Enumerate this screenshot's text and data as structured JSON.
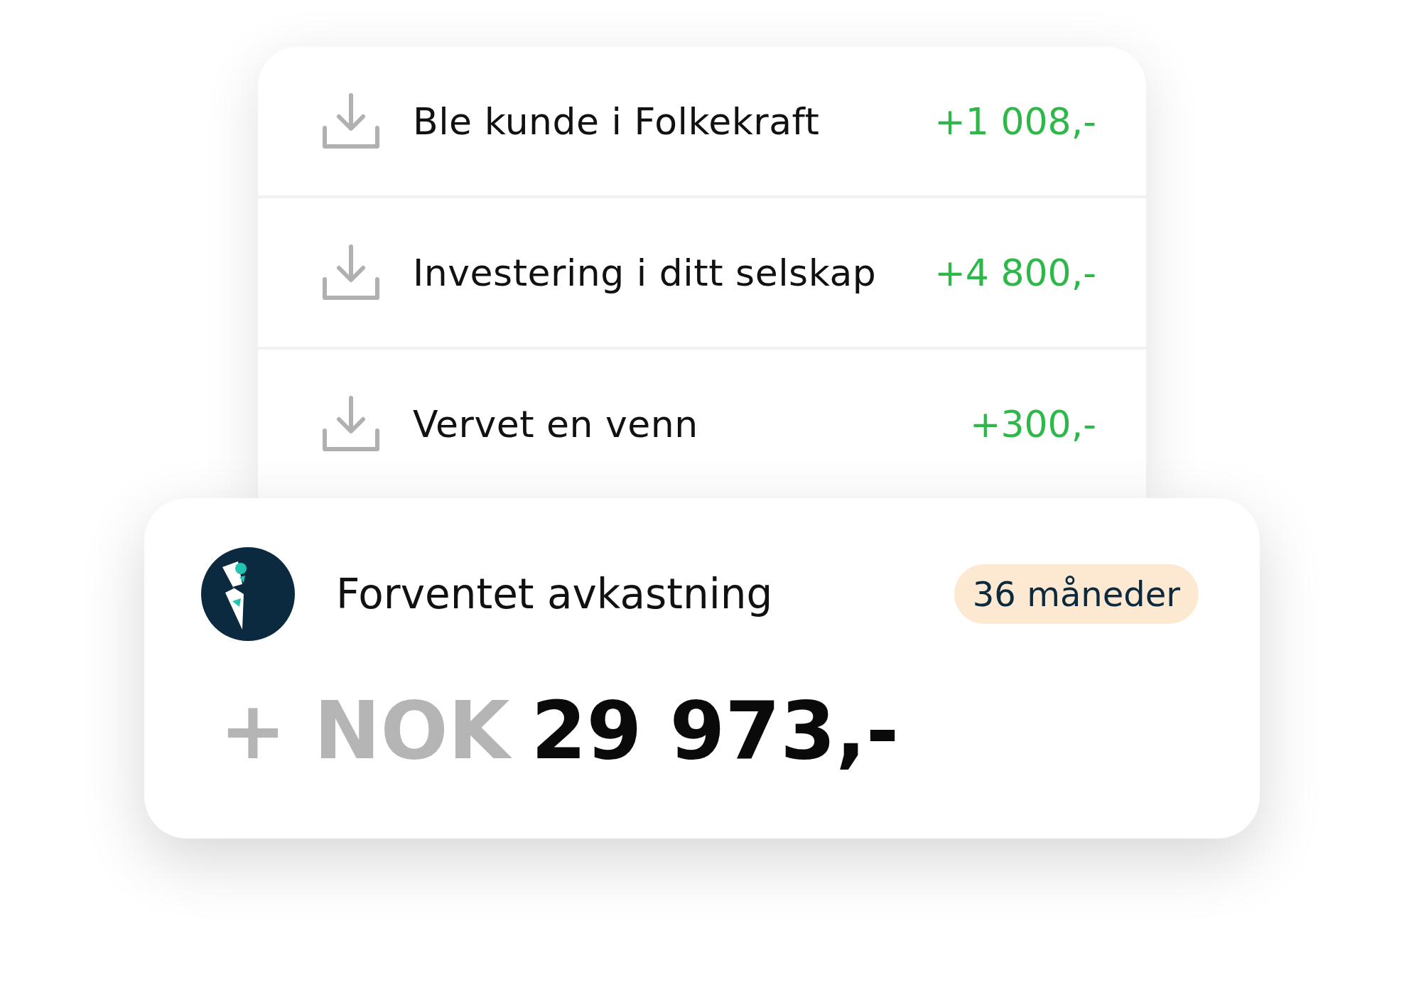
{
  "transactions": [
    {
      "label": "Ble kunde i Folkekraft",
      "amount": "+1 008,-"
    },
    {
      "label": "Investering i ditt selskap",
      "amount": "+4 800,-"
    },
    {
      "label": "Vervet en venn",
      "amount": "+300,-"
    }
  ],
  "summary": {
    "title": "Forventet avkastning",
    "badge": "36 måneder",
    "prefix": "+ NOK",
    "amount": "29 973,-"
  }
}
